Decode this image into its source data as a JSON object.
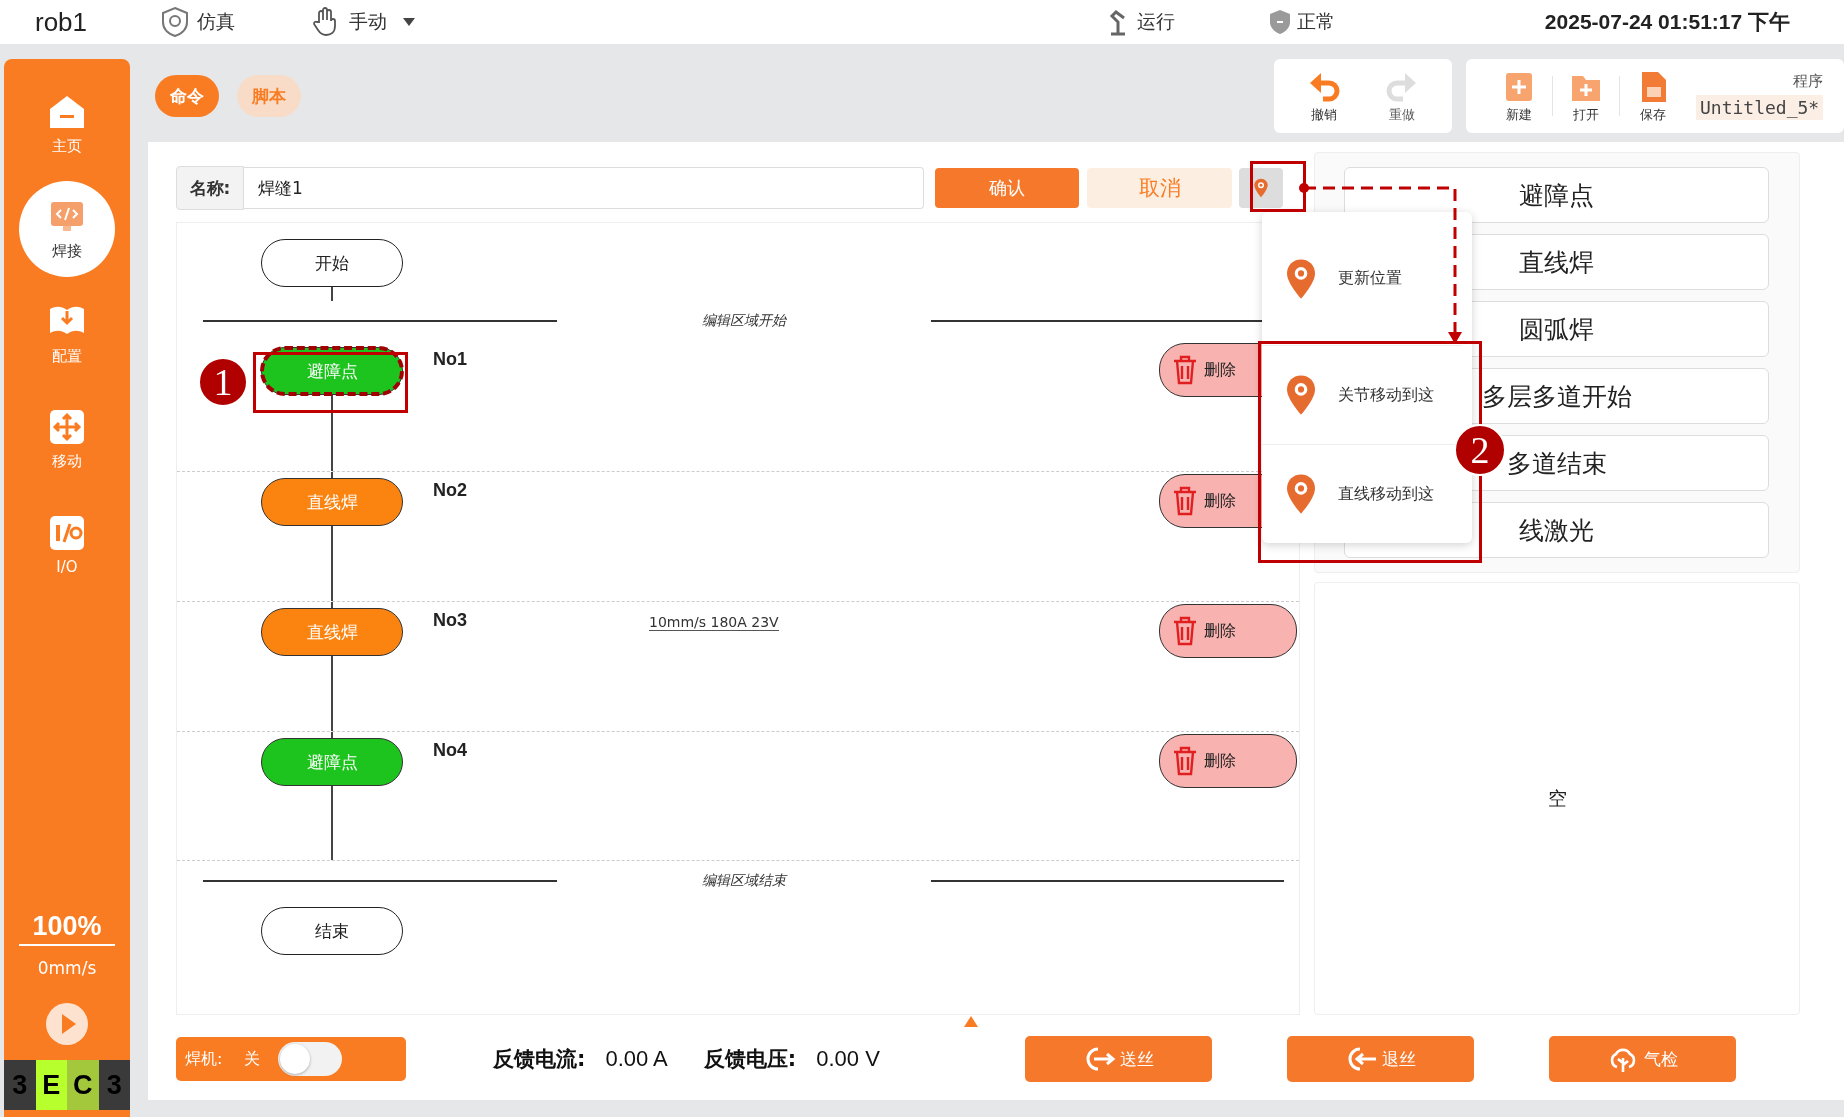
{
  "top_bar": {
    "title": "rob1",
    "mode": "仿真",
    "control": "手动",
    "run_state": "运行",
    "status": "正常",
    "datetime": "2025-07-24 01:51:17 下午"
  },
  "sidebar": {
    "items": [
      {
        "label": "主页",
        "kind": "home",
        "selected": false
      },
      {
        "label": "焊接",
        "kind": "weld",
        "selected": true
      },
      {
        "label": "配置",
        "kind": "config",
        "selected": false
      },
      {
        "label": "移动",
        "kind": "move",
        "selected": false
      },
      {
        "label": "I/O",
        "kind": "io",
        "selected": false
      }
    ],
    "speed_percent": "100%",
    "speed": "0mm/s",
    "badge": [
      {
        "text": "3",
        "color": "#3a3a3a"
      },
      {
        "text": "E",
        "color": "#b8ff2e"
      },
      {
        "text": "C",
        "color": "#a3c83c"
      },
      {
        "text": "3",
        "color": "#3a3a3a"
      }
    ]
  },
  "tabs": [
    {
      "label": "命令",
      "selected": true
    },
    {
      "label": "脚本",
      "selected": false
    }
  ],
  "toolbar": {
    "edit_buttons": [
      {
        "label": "撤销",
        "kind": "undo",
        "disabled": false
      },
      {
        "label": "重做",
        "kind": "redo",
        "disabled": true
      }
    ],
    "file_buttons": [
      {
        "label": "新建",
        "kind": "new"
      },
      {
        "label": "打开",
        "kind": "open"
      },
      {
        "label": "保存",
        "kind": "save"
      }
    ],
    "program_label": "程序",
    "program_name": "Untitled_5*"
  },
  "editor": {
    "name_label": "名称:",
    "name_value": "焊缝1",
    "confirm": "确认",
    "cancel": "取消",
    "start": "开始",
    "region_start": "编辑区域开始",
    "steps": [
      {
        "label": "避障点",
        "kind": "waypoint",
        "number": "No1",
        "highlighted": true,
        "delete": "删除"
      },
      {
        "label": "直线焊",
        "kind": "weld",
        "number": "No2",
        "highlighted": false,
        "delete": "删除"
      },
      {
        "label": "直线焊",
        "kind": "weld",
        "number": "No3",
        "params": "10mm/s 180A 23V",
        "highlighted": false,
        "delete": "删除"
      },
      {
        "label": "避障点",
        "kind": "waypoint",
        "number": "No4",
        "highlighted": false,
        "delete": "删除"
      }
    ],
    "region_end": "编辑区域结束",
    "end": "结束"
  },
  "position_menu": {
    "items": [
      "更新位置",
      "关节移动到这",
      "直线移动到这"
    ]
  },
  "command_list": {
    "items": [
      "避障点",
      "直线焊",
      "圆弧焊",
      "多层多道开始",
      "多道结束",
      "线激光"
    ],
    "empty_text": "空"
  },
  "bottom_bar": {
    "welder_label": "焊机:",
    "welder_state": "关",
    "welder_on": false,
    "current_label": "反馈电流:",
    "current": "0.00 A",
    "voltage_label": "反馈电压:",
    "voltage": "0.00 V",
    "buttons": [
      {
        "label": "送丝",
        "kind": "feed"
      },
      {
        "label": "退丝",
        "kind": "retract"
      },
      {
        "label": "气检",
        "kind": "gas"
      }
    ]
  },
  "annotations": [
    {
      "label": "1"
    },
    {
      "label": "2"
    }
  ]
}
